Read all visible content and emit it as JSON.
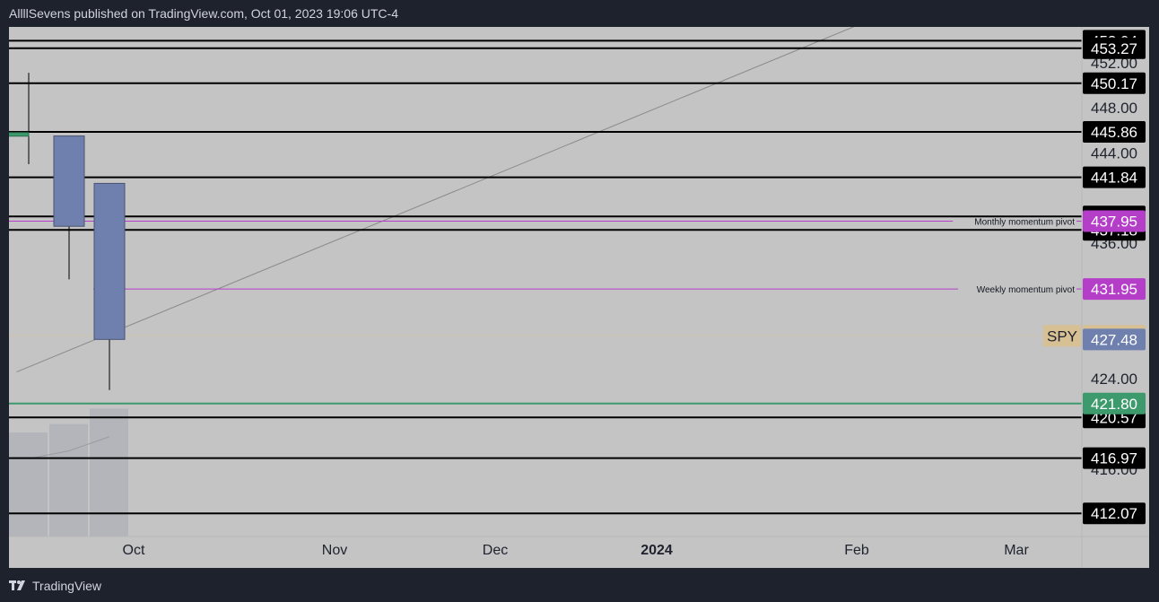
{
  "header": {
    "text": "AllllSevens published on TradingView.com, Oct 01, 2023 19:06 UTC-4"
  },
  "footer": {
    "brand": "TradingView"
  },
  "colors": {
    "page_bg": "#1e222d",
    "chart_bg": "#c4c4c4",
    "candle_fill": "#6f80ae",
    "candle_border": "#4a5470",
    "level_line": "#000000",
    "pivot_line": "#b43ec8",
    "support_line": "#3d9a6c",
    "price_line": "#d7c094",
    "trend_line": "#8a8a8a",
    "volume": "#b0b3ba"
  },
  "chart_data": {
    "type": "candlestick",
    "symbol": "SPY",
    "y_axis": {
      "min": 410.5,
      "max": 455.0,
      "ticks": [
        "452.00",
        "448.00",
        "444.00",
        "436.00",
        "424.00",
        "416.00"
      ],
      "tick_values": [
        452,
        448,
        444,
        436,
        424,
        416
      ]
    },
    "x_axis": {
      "labels": [
        {
          "text": "Oct",
          "bold": false
        },
        {
          "text": "Nov",
          "bold": false
        },
        {
          "text": "Dec",
          "bold": false
        },
        {
          "text": "2024",
          "bold": true
        },
        {
          "text": "Feb",
          "bold": false
        },
        {
          "text": "Mar",
          "bold": false
        }
      ]
    },
    "candles": [
      {
        "period": 0,
        "open": 445.8,
        "high": 451.1,
        "low": 443.0,
        "close": 445.5
      },
      {
        "period": 1,
        "open": 445.5,
        "high": 445.5,
        "low": 432.8,
        "close": 437.5
      },
      {
        "period": 2,
        "open": 441.3,
        "high": 441.3,
        "low": 423.0,
        "close": 427.48
      }
    ],
    "volume": [
      0.61,
      0.66,
      0.75
    ],
    "horizontal_levels": [
      {
        "value": 453.94,
        "label": "453.94",
        "kind": "level"
      },
      {
        "value": 453.27,
        "label": "453.27",
        "kind": "level"
      },
      {
        "value": 450.17,
        "label": "450.17",
        "kind": "level"
      },
      {
        "value": 445.86,
        "label": "445.86",
        "kind": "level"
      },
      {
        "value": 441.84,
        "label": "441.84",
        "kind": "level"
      },
      {
        "value": 438.37,
        "label": "438.37",
        "kind": "level"
      },
      {
        "value": 437.18,
        "label": "437.18",
        "kind": "level"
      },
      {
        "value": 420.57,
        "label": "420.57",
        "kind": "level"
      },
      {
        "value": 416.97,
        "label": "416.97",
        "kind": "level"
      },
      {
        "value": 412.07,
        "label": "412.07",
        "kind": "level"
      }
    ],
    "pivots": [
      {
        "value": 437.95,
        "label": "437.95",
        "note": "Monthly momentum pivot"
      },
      {
        "value": 431.95,
        "label": "431.95",
        "note": "Weekly momentum pivot"
      }
    ],
    "support": {
      "value": 421.8,
      "label": "421.80"
    },
    "last_price": {
      "value": 427.8,
      "label": "427.80",
      "tag": "SPY"
    },
    "close_price": {
      "value": 427.48,
      "label": "427.48"
    },
    "trend_line": {
      "from": {
        "period": -0.3,
        "price": 424.6
      },
      "to": {
        "period": 21,
        "price": 456.0
      }
    }
  }
}
